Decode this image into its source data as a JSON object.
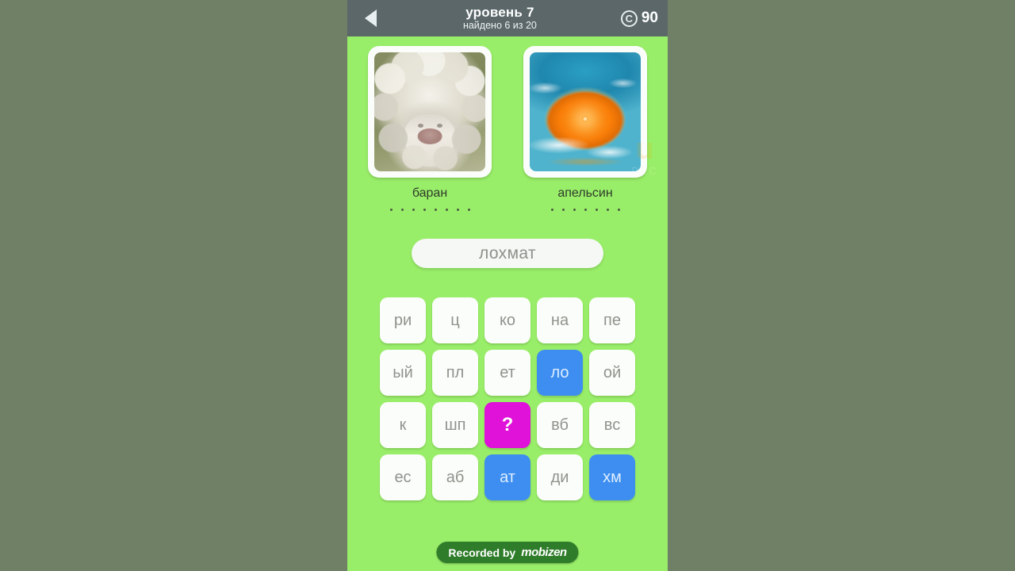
{
  "app": {
    "background_color": "#6f8067",
    "screen_color": "#99ee69"
  },
  "header": {
    "back_icon": "back-arrow-icon",
    "title": "уровень 7",
    "progress": "найдено 6 из 20",
    "coin_icon": "coin-icon",
    "coin_glyph": "C",
    "coin_count": "90",
    "background_color": "#5b6769"
  },
  "puzzle": {
    "cards": [
      {
        "image": "fluffy-sheep-photo",
        "label": "баран",
        "dot_count": 8
      },
      {
        "image": "orange-in-water-splash-photo",
        "label": "апельсин",
        "dot_count": 7
      }
    ]
  },
  "answer": {
    "value": "лохмат",
    "placeholder": ""
  },
  "tiles": [
    {
      "label": "ри",
      "state": "default"
    },
    {
      "label": "ц",
      "state": "default"
    },
    {
      "label": "ко",
      "state": "default"
    },
    {
      "label": "на",
      "state": "default"
    },
    {
      "label": "пе",
      "state": "default"
    },
    {
      "label": "ый",
      "state": "default"
    },
    {
      "label": "пл",
      "state": "default"
    },
    {
      "label": "ет",
      "state": "default"
    },
    {
      "label": "ло",
      "state": "selected"
    },
    {
      "label": "ой",
      "state": "default"
    },
    {
      "label": "к",
      "state": "default"
    },
    {
      "label": "шп",
      "state": "default"
    },
    {
      "label": "?",
      "state": "hint"
    },
    {
      "label": "вб",
      "state": "default"
    },
    {
      "label": "вс",
      "state": "default"
    },
    {
      "label": "ес",
      "state": "default"
    },
    {
      "label": "аб",
      "state": "default"
    },
    {
      "label": "ат",
      "state": "selected"
    },
    {
      "label": "ди",
      "state": "default"
    },
    {
      "label": "хм",
      "state": "selected"
    }
  ],
  "colors": {
    "tile_default_bg": "#fbfdfa",
    "tile_default_text": "#8e948c",
    "tile_selected_bg": "#3d8ef0",
    "tile_hint_bg": "#e011d8"
  },
  "watermarks": {
    "urec_letter": "u",
    "urec_label": "REC",
    "recorder_prefix": "Recorded by",
    "recorder_brand": "mobizen"
  }
}
